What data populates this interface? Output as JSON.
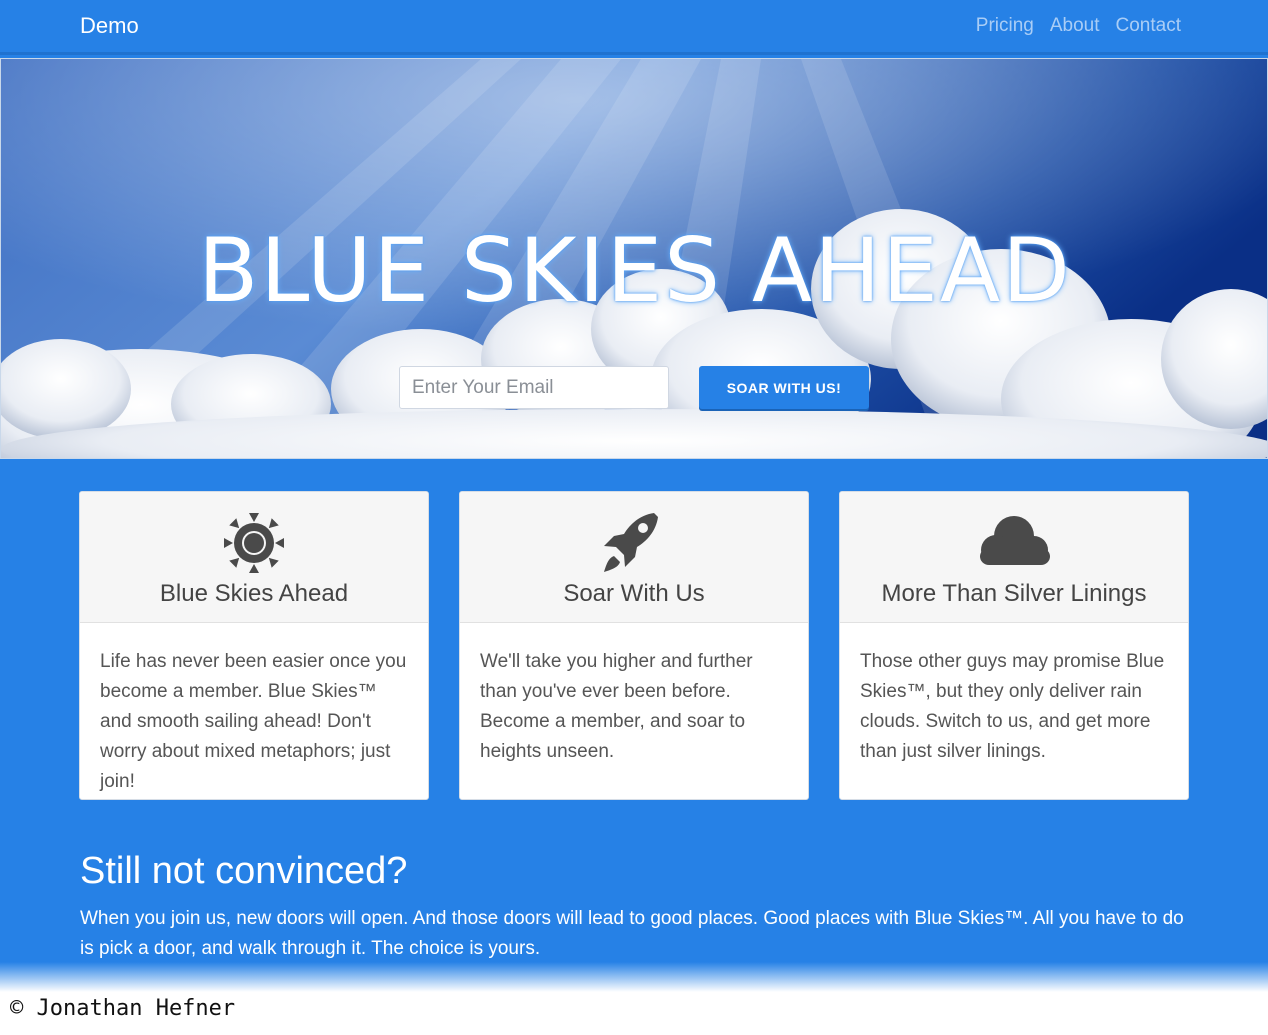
{
  "navbar": {
    "brand": "Demo",
    "links": [
      "Pricing",
      "About",
      "Contact"
    ]
  },
  "hero": {
    "title": "BLUE SKIES AHEAD",
    "email_placeholder": "Enter Your Email",
    "button_label": "SOAR WITH US!"
  },
  "cards": [
    {
      "icon": "sun-icon",
      "title": "Blue Skies Ahead",
      "text": "Life has never been easier once you become a member. Blue Skies™ and smooth sailing ahead! Don't worry about mixed metaphors; just join!"
    },
    {
      "icon": "rocket-icon",
      "title": "Soar With Us",
      "text": "We'll take you higher and further than you've ever been before. Become a member, and soar to heights unseen."
    },
    {
      "icon": "cloud-icon",
      "title": "More Than Silver Linings",
      "text": "Those other guys may promise Blue Skies™, but they only deliver rain clouds. Switch to us, and get more than just silver linings."
    }
  ],
  "cta": {
    "title": "Still not convinced?",
    "text": "When you join us, new doors will open. And those doors will lead to good places. Good places with Blue Skies™. All you have to do is pick a door, and walk through it. The choice is yours."
  },
  "footer": {
    "copyright": "© Jonathan Hefner"
  },
  "colors": {
    "primary": "#2681e6",
    "icon": "#4a4a4a",
    "card_header": "#f6f6f6"
  }
}
